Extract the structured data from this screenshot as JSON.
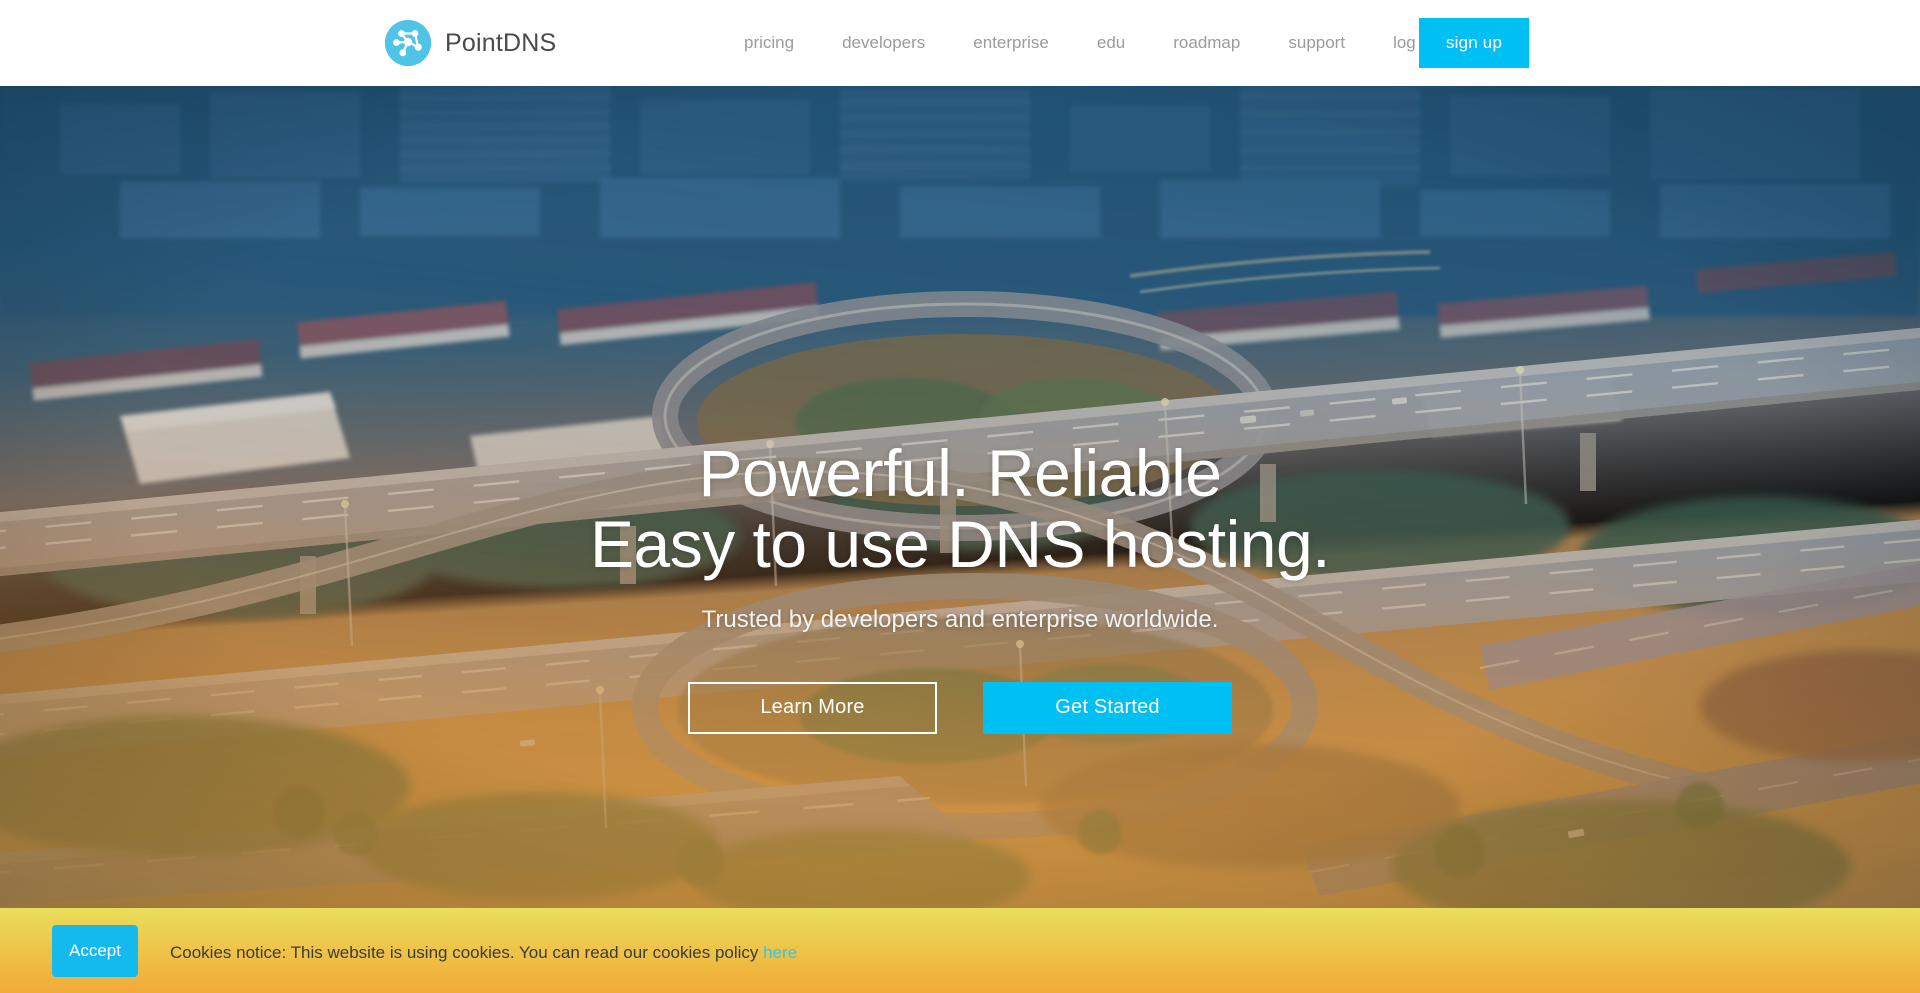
{
  "header": {
    "brand": {
      "name": "PointDNS",
      "icon": "network-nodes-icon",
      "icon_color": "#4FC3E8"
    },
    "nav_links": [
      {
        "label": "pricing",
        "name": "nav-link-pricing"
      },
      {
        "label": "developers",
        "name": "nav-link-developers"
      },
      {
        "label": "enterprise",
        "name": "nav-link-enterprise"
      },
      {
        "label": "edu",
        "name": "nav-link-edu"
      },
      {
        "label": "roadmap",
        "name": "nav-link-roadmap"
      },
      {
        "label": "support",
        "name": "nav-link-support"
      },
      {
        "label": "log in",
        "name": "nav-link-login"
      }
    ],
    "signup_label": "sign up",
    "signup_color": "#00BFF3"
  },
  "hero": {
    "title_line1": "Powerful. Reliable",
    "title_line2": "Easy to use DNS hosting.",
    "subtitle": "Trusted by developers and enterprise worldwide.",
    "primary_cta": "Get Started",
    "secondary_cta": "Learn More",
    "background": "aerial-city-highway-interchange-photo"
  },
  "cookie_notice": {
    "accept_label": "Accept",
    "message": "Cookies notice: This website is using cookies. You can read our cookies policy",
    "link_label": "here",
    "accent_color": "#2ec6f0",
    "gradient_top": "#e9df5c",
    "gradient_bottom": "#f2ab38"
  }
}
